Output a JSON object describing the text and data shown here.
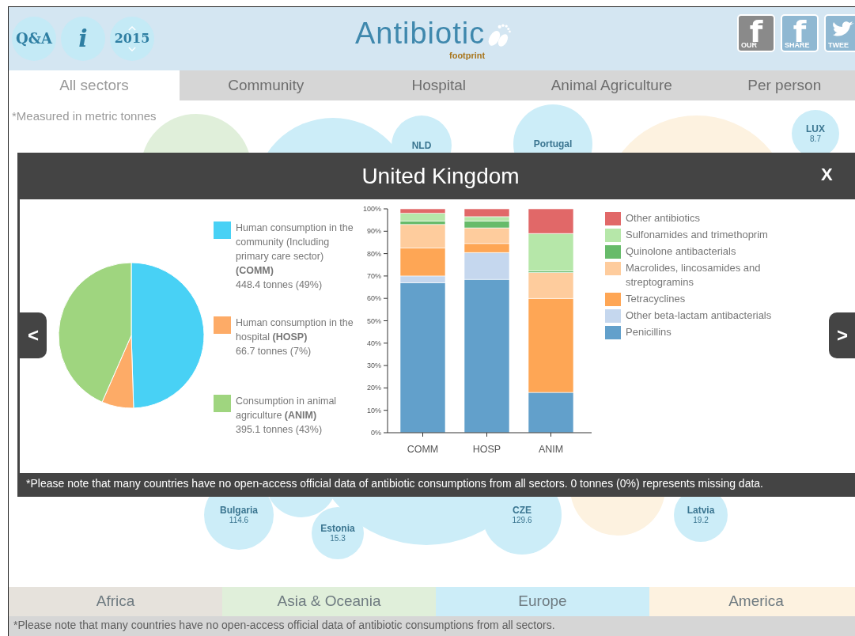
{
  "header": {
    "round_buttons": [
      {
        "kind": "text",
        "label": "Q&A"
      },
      {
        "kind": "info",
        "label": "i"
      },
      {
        "kind": "year",
        "label": "2015"
      }
    ],
    "logo": {
      "title": "Antibiotic",
      "subtitle": "footprint"
    },
    "social": [
      {
        "kind": "facebook",
        "glyph": "f",
        "caption": "OUR",
        "selected": true
      },
      {
        "kind": "facebook",
        "glyph": "f",
        "caption": "SHARE",
        "selected": false
      },
      {
        "kind": "twitter",
        "caption": "TWEE",
        "selected": false
      }
    ]
  },
  "tabs": [
    {
      "label": "All sectors",
      "selected": true
    },
    {
      "label": "Community",
      "selected": false
    },
    {
      "label": "Hospital",
      "selected": false
    },
    {
      "label": "Animal Agriculture",
      "selected": false
    },
    {
      "label": "Per person",
      "selected": false
    }
  ],
  "note_top": "*Measured in metric tonnes",
  "bubbles": [
    {
      "color": "#e0efda"
    },
    {
      "color": "#ccedf8"
    },
    {
      "label": "NLD",
      "color": "#ccedf8"
    },
    {
      "label": "Portugal",
      "color": "#ccedf8"
    },
    {
      "color": "#fdf2e0"
    },
    {
      "label": "LUX",
      "value": "8.7",
      "color": "#ccedf8"
    },
    {
      "label": "Bulgaria",
      "value": "114.6",
      "color": "#ccedf8"
    },
    {
      "color": "#ccedf8"
    },
    {
      "label": "Estonia",
      "value": "15.3",
      "color": "#ccedf8"
    },
    {
      "color": "#ccedf8"
    },
    {
      "label": "CZE",
      "value": "129.6",
      "color": "#ccedf8"
    },
    {
      "color": "#fdf2e0"
    },
    {
      "label": "Latvia",
      "value": "19.2",
      "color": "#ccedf8"
    }
  ],
  "modal": {
    "title": "United Kingdom",
    "close": "X",
    "prev": "<",
    "next": ">",
    "pie_legend": [
      {
        "label": "Human consumption in the community (Including primary care sector) **(COMM)**",
        "amount": "448.4 tonnes (49%)",
        "color": "#48d1f5"
      },
      {
        "label": "Human consumption in the hospital **(HOSP)**",
        "amount": "66.7 tonnes (7%)",
        "color": "#fdab67"
      },
      {
        "label": "Consumption in animal agriculture **(ANIM)**",
        "amount": "395.1 tonnes (43%)",
        "color": "#9fd57f"
      }
    ],
    "pie": {
      "chart_data": {
        "type": "pie",
        "values": [
          49,
          7,
          43
        ]
      }
    },
    "bars": {
      "chart_data": {
        "type": "bar",
        "stacked": true,
        "categories": [
          "COMM",
          "HOSP",
          "ANIM"
        ],
        "ylim": [
          0,
          100
        ],
        "yticks": [
          {
            "value": 0,
            "label": "0%"
          },
          {
            "value": 10,
            "label": "10%"
          },
          {
            "value": 20,
            "label": "20%"
          },
          {
            "value": 30,
            "label": "30%"
          },
          {
            "value": 40,
            "label": "40%"
          },
          {
            "value": 50,
            "label": "50%"
          },
          {
            "value": 60,
            "label": "60%"
          },
          {
            "value": 70,
            "label": "70%"
          },
          {
            "value": 80,
            "label": "80%"
          },
          {
            "value": 90,
            "label": "90%"
          },
          {
            "value": 100,
            "label": "100%"
          }
        ],
        "series": [
          {
            "name": "Penicillins",
            "color": "#62a0cb",
            "values": [
              67,
              68.5,
              18
            ]
          },
          {
            "name": "Other beta-lactam antibacterials",
            "color": "#c5d7ee",
            "values": [
              3,
              12,
              0
            ]
          },
          {
            "name": "Tetracyclines",
            "color": "#fea655",
            "values": [
              12.5,
              4,
              42
            ]
          },
          {
            "name": "Macrolides, lincosamides and streptogramins",
            "color": "#fecc9d",
            "values": [
              10.5,
              7,
              11.5
            ]
          },
          {
            "name": "Quinolone antibacterials",
            "color": "#67bb6a",
            "values": [
              1.5,
              3,
              0.8
            ]
          },
          {
            "name": "Sulfonamides and trimethoprim",
            "color": "#b6e7a9",
            "values": [
              3.5,
              2,
              16.7
            ]
          },
          {
            "name": "Other antibiotics",
            "color": "#e16868",
            "values": [
              2,
              3.5,
              11
            ]
          }
        ]
      }
    },
    "footnote": "*Please note that many countries have no open-access official data of antibiotic consumptions from all sectors. 0 tonnes (0%) represents missing data."
  },
  "regions": [
    {
      "label": "Africa",
      "color": "#e6e2dc"
    },
    {
      "label": "Asia & Oceania",
      "color": "#e0efda"
    },
    {
      "label": "Europe",
      "color": "#ccedf8"
    },
    {
      "label": "America",
      "color": "#fdf2e0"
    }
  ],
  "note_bottom": "*Please note that many countries have no open-access official data of antibiotic consumptions from all sectors."
}
